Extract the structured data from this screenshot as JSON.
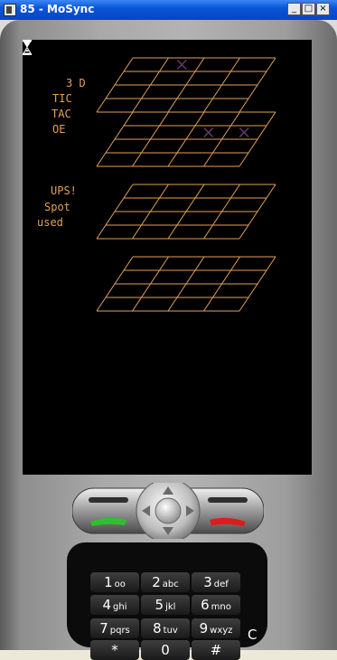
{
  "window": {
    "title": "85 - MoSync",
    "minimize_glyph": "_",
    "maximize_glyph": "□",
    "close_glyph": "×"
  },
  "game": {
    "title_lines": [
      "3 D",
      "TIC",
      "TAC",
      "OE"
    ],
    "message_lines": [
      "UPS!",
      "Spot",
      "used"
    ],
    "colors": {
      "grid": "#e2a15a",
      "marker": "#6e3a7a",
      "screen": "#000000"
    },
    "markers": [
      {
        "layer": 1,
        "row": 1,
        "col": 2
      },
      {
        "layer": 2,
        "row": 2,
        "col": 3
      },
      {
        "layer": 2,
        "row": 2,
        "col": 4
      }
    ]
  },
  "keypad": {
    "keys": [
      {
        "digit": "1",
        "letters": "oo"
      },
      {
        "digit": "2",
        "letters": "abc"
      },
      {
        "digit": "3",
        "letters": "def"
      },
      {
        "digit": "4",
        "letters": "ghi"
      },
      {
        "digit": "5",
        "letters": "jkl"
      },
      {
        "digit": "6",
        "letters": "mno"
      },
      {
        "digit": "7",
        "letters": "pqrs"
      },
      {
        "digit": "8",
        "letters": "tuv"
      },
      {
        "digit": "9",
        "letters": "wxyz"
      },
      {
        "digit": "*",
        "letters": ""
      },
      {
        "digit": "0",
        "letters": ""
      },
      {
        "digit": "#",
        "letters": ""
      }
    ],
    "clear_label": "C"
  },
  "icons": [
    "window-app-icon",
    "hourglass-icon",
    "dpad-up-icon",
    "dpad-down-icon",
    "dpad-left-icon",
    "dpad-right-icon",
    "call-icon",
    "end-call-icon"
  ]
}
